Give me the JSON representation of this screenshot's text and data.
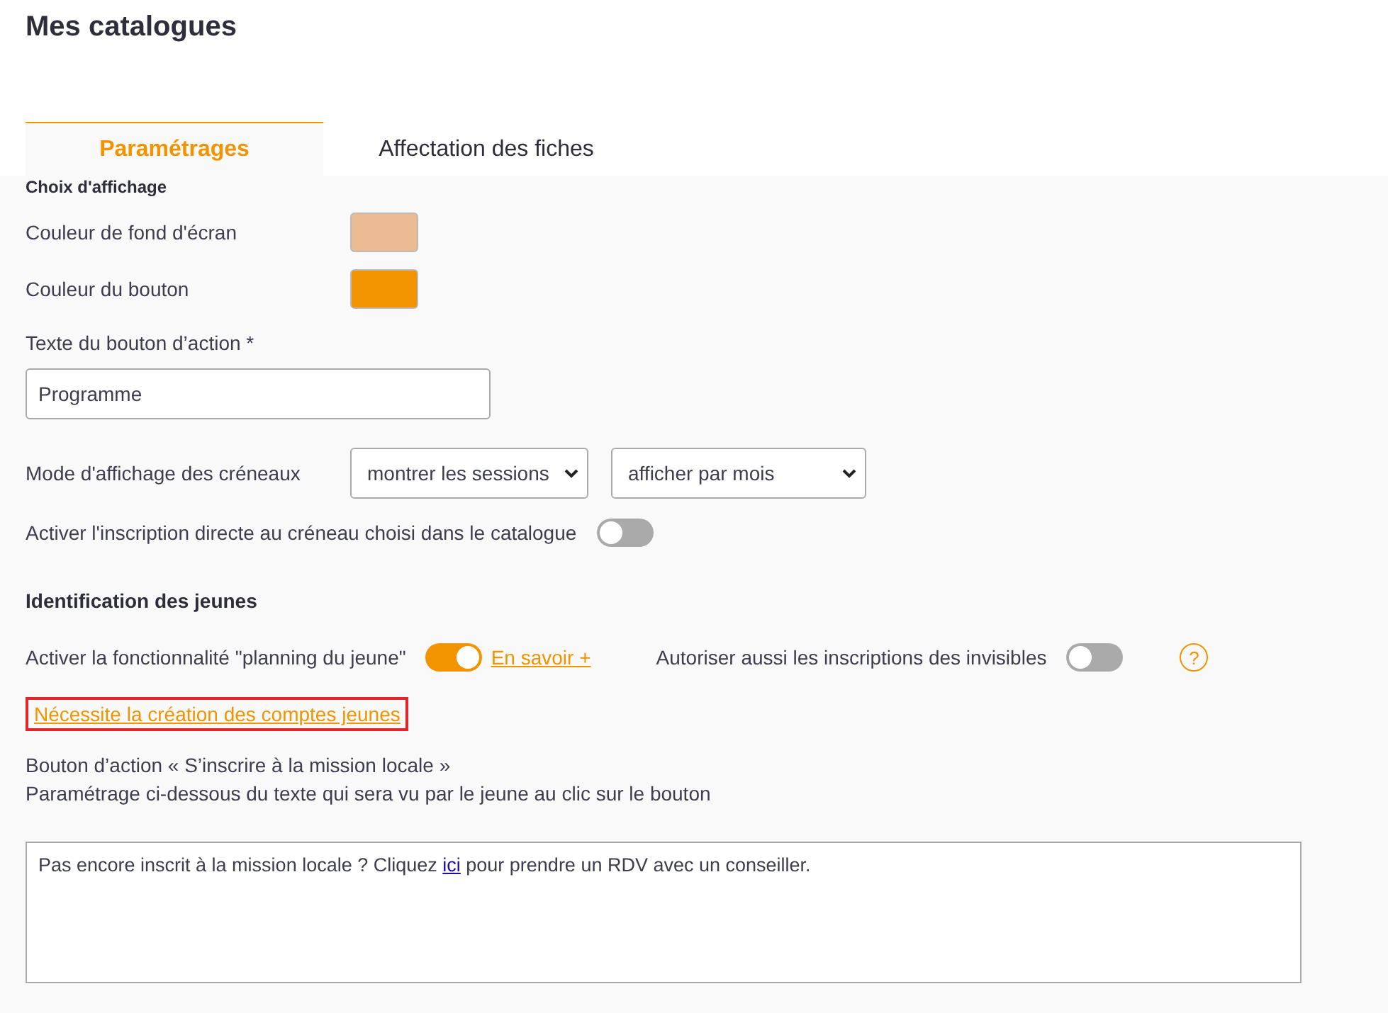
{
  "page_title": "Mes catalogues",
  "tabs": [
    {
      "label": "Paramétrages",
      "selected": true
    },
    {
      "label": "Affectation des fiches",
      "selected": false
    }
  ],
  "display_section": {
    "heading": "Choix d'affichage",
    "colors": [
      {
        "label": "Couleur de fond d'écran",
        "color": "#ebbb93"
      },
      {
        "label": "Couleur du bouton",
        "color": "#f29400"
      }
    ],
    "action_text": {
      "label": "Texte du bouton d’action *",
      "value": "Programme"
    },
    "slot_mode": {
      "label": "Mode d'affichage des créneaux",
      "selects": [
        "montrer les sessions",
        "afficher par mois"
      ]
    },
    "direct_signup": {
      "label": "Activer l'inscription directe au créneau choisi dans le catalogue",
      "on": false
    }
  },
  "identification_section": {
    "heading": "Identification des jeunes",
    "planning": {
      "label": "Activer la fonctionnalité \"planning du jeune\"",
      "on": true,
      "link": "En savoir +"
    },
    "invisibles": {
      "label": "Autoriser aussi les inscriptions des invisibles",
      "on": false
    },
    "help": "?",
    "accounts_link": {
      "text": "Nécessite la création des comptes jeunes",
      "highlighted": true
    },
    "description": [
      "Bouton d’action « S’inscrire à la mission locale »",
      "Paramétrage ci-dessous du texte qui sera vu par le jeune au clic sur le bouton"
    ],
    "editor": {
      "before": "Pas encore inscrit à la mission locale ? Cliquez ",
      "link": "ici",
      "after": " pour prendre un RDV avec un conseiller."
    }
  }
}
